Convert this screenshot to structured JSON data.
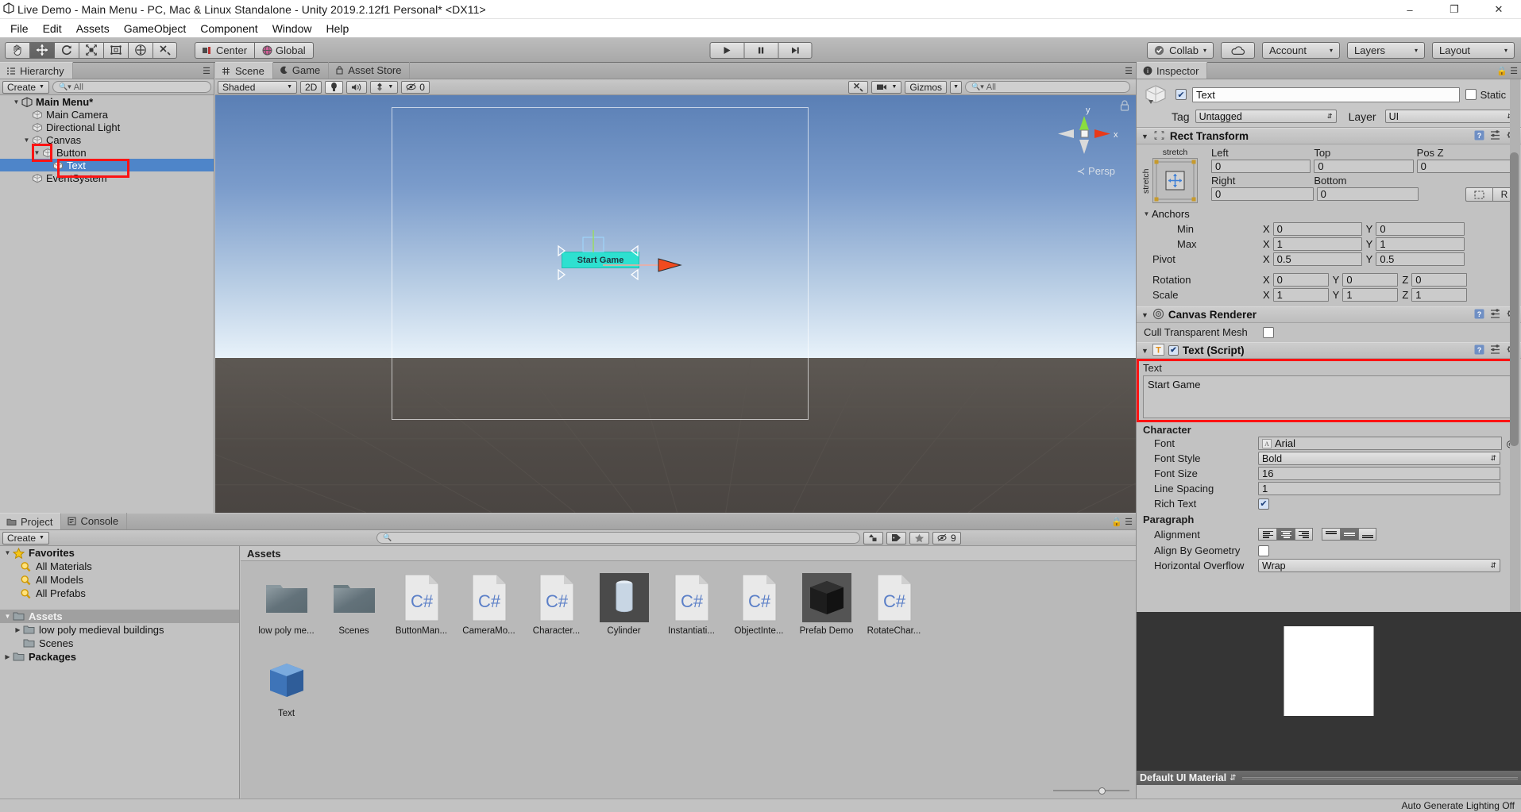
{
  "window": {
    "title": "Live Demo - Main Menu - PC, Mac & Linux Standalone - Unity 2019.2.12f1 Personal* <DX11>",
    "minimize": "–",
    "maximize": "❐",
    "close": "✕"
  },
  "menubar": {
    "items": [
      "File",
      "Edit",
      "Assets",
      "GameObject",
      "Component",
      "Window",
      "Help"
    ]
  },
  "toolbar": {
    "tools": [
      {
        "name": "hand-tool",
        "glyph": "✋"
      },
      {
        "name": "move-tool",
        "glyph": "✥"
      },
      {
        "name": "rotate-tool",
        "glyph": "↻"
      },
      {
        "name": "scale-tool",
        "glyph": "⤡"
      },
      {
        "name": "rect-tool",
        "glyph": "▣"
      },
      {
        "name": "transform-tool",
        "glyph": "✵"
      },
      {
        "name": "custom-tool",
        "glyph": "⚒"
      }
    ],
    "pivot_label": "Center",
    "space_label": "Global",
    "play": "▶",
    "pause": "❙❙",
    "step": "▶❙",
    "collab": "Collab",
    "cloud_icon": "cloud-icon",
    "account": "Account",
    "layers": "Layers",
    "layout": "Layout",
    "caret": "▾"
  },
  "hierarchy": {
    "tab": "Hierarchy",
    "create": "Create",
    "search_placeholder": "All",
    "items": [
      {
        "label": "Main Menu*",
        "depth": 0,
        "arrow": "open",
        "icon": "unity-scene-icon",
        "bold": true,
        "selected": false
      },
      {
        "label": "Main Camera",
        "depth": 1,
        "arrow": "none",
        "icon": "gameobject-icon",
        "bold": false,
        "selected": false
      },
      {
        "label": "Directional Light",
        "depth": 1,
        "arrow": "none",
        "icon": "gameobject-icon",
        "bold": false,
        "selected": false
      },
      {
        "label": "Canvas",
        "depth": 1,
        "arrow": "open",
        "icon": "gameobject-icon",
        "bold": false,
        "selected": false
      },
      {
        "label": "Button",
        "depth": 2,
        "arrow": "open",
        "icon": "gameobject-icon",
        "bold": false,
        "selected": false
      },
      {
        "label": "Text",
        "depth": 3,
        "arrow": "none",
        "icon": "gameobject-icon",
        "bold": false,
        "selected": true
      },
      {
        "label": "EventSystem",
        "depth": 1,
        "arrow": "none",
        "icon": "gameobject-icon",
        "bold": false,
        "selected": false
      }
    ]
  },
  "scene": {
    "tabs": [
      {
        "label": "Scene",
        "icon": "scene-icon",
        "selected": true
      },
      {
        "label": "Game",
        "icon": "game-icon",
        "selected": false
      },
      {
        "label": "Asset Store",
        "icon": "store-icon",
        "selected": false
      }
    ],
    "draw_mode": "Shaded",
    "two_d": "2D",
    "light_icon": "lighting-icon",
    "audio_icon": "audio-icon",
    "fx_icon": "effects-icon",
    "hidden_count": "0",
    "tools_icon": "scene-tools-icon",
    "camera_icon": "scene-camera-icon",
    "gizmos": "Gizmos",
    "search_placeholder": "All",
    "persp_label": "Persp",
    "axis_x": "x",
    "axis_y": "y",
    "lock_icon": "lock-icon",
    "button_text": "Start Game"
  },
  "project": {
    "tabs": [
      {
        "label": "Project",
        "icon": "folder-icon",
        "selected": true
      },
      {
        "label": "Console",
        "icon": "console-icon",
        "selected": false
      }
    ],
    "create": "Create",
    "search_placeholder": "",
    "filter_icons": [
      "asset-type-filter-icon",
      "label-filter-icon",
      "favorite-filter-icon",
      "hidden-packages-icon"
    ],
    "hidden_count": "9",
    "tree": [
      {
        "label": "Favorites",
        "depth": 0,
        "arrow": "open",
        "icon": "star-icon",
        "bold": true
      },
      {
        "label": "All Materials",
        "depth": 1,
        "arrow": "none",
        "icon": "search-saved-icon",
        "bold": false
      },
      {
        "label": "All Models",
        "depth": 1,
        "arrow": "none",
        "icon": "search-saved-icon",
        "bold": false
      },
      {
        "label": "All Prefabs",
        "depth": 1,
        "arrow": "none",
        "icon": "search-saved-icon",
        "bold": false
      },
      {
        "label": "Assets",
        "depth": 0,
        "arrow": "open",
        "icon": "folder-icon",
        "bold": true,
        "header": true
      },
      {
        "label": "low poly medieval buildings",
        "depth": 1,
        "arrow": "closed",
        "icon": "folder-icon",
        "bold": false
      },
      {
        "label": "Scenes",
        "depth": 1,
        "arrow": "none",
        "icon": "folder-icon",
        "bold": false
      },
      {
        "label": "Packages",
        "depth": 0,
        "arrow": "closed",
        "icon": "folder-icon",
        "bold": true
      }
    ],
    "breadcrumb": "Assets",
    "assets": [
      {
        "label": "low poly me...",
        "kind": "folder"
      },
      {
        "label": "Scenes",
        "kind": "folder"
      },
      {
        "label": "ButtonMan...",
        "kind": "cs"
      },
      {
        "label": "CameraMo...",
        "kind": "cs"
      },
      {
        "label": "Character...",
        "kind": "cs"
      },
      {
        "label": "Cylinder",
        "kind": "mesh-cylinder"
      },
      {
        "label": "Instantiati...",
        "kind": "cs"
      },
      {
        "label": "ObjectInte...",
        "kind": "cs"
      },
      {
        "label": "Prefab Demo",
        "kind": "mesh-cube"
      },
      {
        "label": "RotateChar...",
        "kind": "cs"
      },
      {
        "label": "Text",
        "kind": "mesh-blue-cube"
      }
    ]
  },
  "inspector": {
    "tab": "Inspector",
    "object_name": "Text",
    "enabled": true,
    "static_label": "Static",
    "tag_label": "Tag",
    "tag_value": "Untagged",
    "layer_label": "Layer",
    "layer_value": "UI",
    "rect_transform": {
      "title": "Rect Transform",
      "anchor_preset_top": "stretch",
      "anchor_preset_side": "stretch",
      "fields": [
        {
          "label": "Left",
          "value": "0"
        },
        {
          "label": "Top",
          "value": "0"
        },
        {
          "label": "Pos Z",
          "value": "0"
        },
        {
          "label": "Right",
          "value": "0"
        },
        {
          "label": "Bottom",
          "value": "0"
        }
      ],
      "blueprint_btn": "blueprint-mode-icon",
      "raw_btn": "R",
      "anchors_label": "Anchors",
      "min_label": "Min",
      "min_x": "0",
      "min_y": "0",
      "max_label": "Max",
      "max_x": "1",
      "max_y": "1",
      "pivot_label": "Pivot",
      "pivot_x": "0.5",
      "pivot_y": "0.5",
      "rotation_label": "Rotation",
      "rot_x": "0",
      "rot_y": "0",
      "rot_z": "0",
      "scale_label": "Scale",
      "scale_x": "1",
      "scale_y": "1",
      "scale_z": "1"
    },
    "canvas_renderer": {
      "title": "Canvas Renderer",
      "cull_label": "Cull Transparent Mesh",
      "cull_checked": false
    },
    "text_script": {
      "title": "Text (Script)",
      "enabled": true,
      "text_label": "Text",
      "text_value": "Start Game",
      "character_label": "Character",
      "font_label": "Font",
      "font_value": "Arial",
      "font_style_label": "Font Style",
      "font_style_value": "Bold",
      "font_size_label": "Font Size",
      "font_size_value": "16",
      "line_spacing_label": "Line Spacing",
      "line_spacing_value": "1",
      "rich_text_label": "Rich Text",
      "rich_text_checked": true,
      "paragraph_label": "Paragraph",
      "alignment_label": "Alignment",
      "align_h_selected": 1,
      "align_v_selected": 1,
      "align_by_geometry_label": "Align By Geometry",
      "align_by_geometry_checked": false,
      "h_overflow_label": "Horizontal Overflow",
      "h_overflow_value": "Wrap"
    },
    "material_bar": "Default UI Material"
  },
  "statusbar": {
    "text": "Auto Generate Lighting Off"
  }
}
